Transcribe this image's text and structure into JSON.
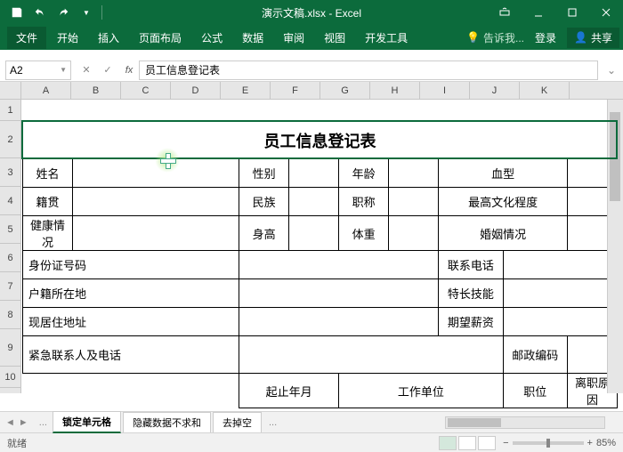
{
  "titlebar": {
    "title": "演示文稿.xlsx - Excel"
  },
  "tabs": {
    "file": "文件",
    "home": "开始",
    "insert": "插入",
    "layout": "页面布局",
    "formula": "公式",
    "data": "数据",
    "review": "审阅",
    "view": "视图",
    "dev": "开发工具",
    "tellme": "告诉我...",
    "login": "登录",
    "share": "共享"
  },
  "namebox": {
    "ref": "A2"
  },
  "formula": {
    "value": "员工信息登记表"
  },
  "cols": [
    "A",
    "B",
    "C",
    "D",
    "E",
    "F",
    "G",
    "H",
    "I",
    "J",
    "K"
  ],
  "rows": [
    "1",
    "2",
    "3",
    "4",
    "5",
    "6",
    "7",
    "8",
    "9",
    "10"
  ],
  "form": {
    "title": "员工信息登记表",
    "r3": {
      "c1": "姓名",
      "c2": "性别",
      "c3": "年龄",
      "c4": "血型"
    },
    "r4": {
      "c1": "籍贯",
      "c2": "民族",
      "c3": "职称",
      "c4": "最高文化程度"
    },
    "r5": {
      "c1": "健康情况",
      "c2": "身高",
      "c3": "体重",
      "c4": "婚姻情况"
    },
    "r6": {
      "c1": "身份证号码",
      "c2": "联系电话"
    },
    "r7": {
      "c1": "户籍所在地",
      "c2": "特长技能"
    },
    "r8": {
      "c1": "现居住地址",
      "c2": "期望薪资"
    },
    "r9": {
      "c1": "紧急联系人及电话",
      "c2": "邮政编码"
    },
    "r10": {
      "c1": "起止年月",
      "c2": "工作单位",
      "c3": "职位",
      "c4": "离职原因"
    }
  },
  "sheets": {
    "active": "锁定单元格",
    "s2": "隐藏数据不求和",
    "s3": "去掉空",
    "nav1": "◄",
    "nav2": "►",
    "dots": "..."
  },
  "status": {
    "ready": "就绪",
    "zoom": "85%",
    "minus": "−",
    "plus": "+"
  }
}
